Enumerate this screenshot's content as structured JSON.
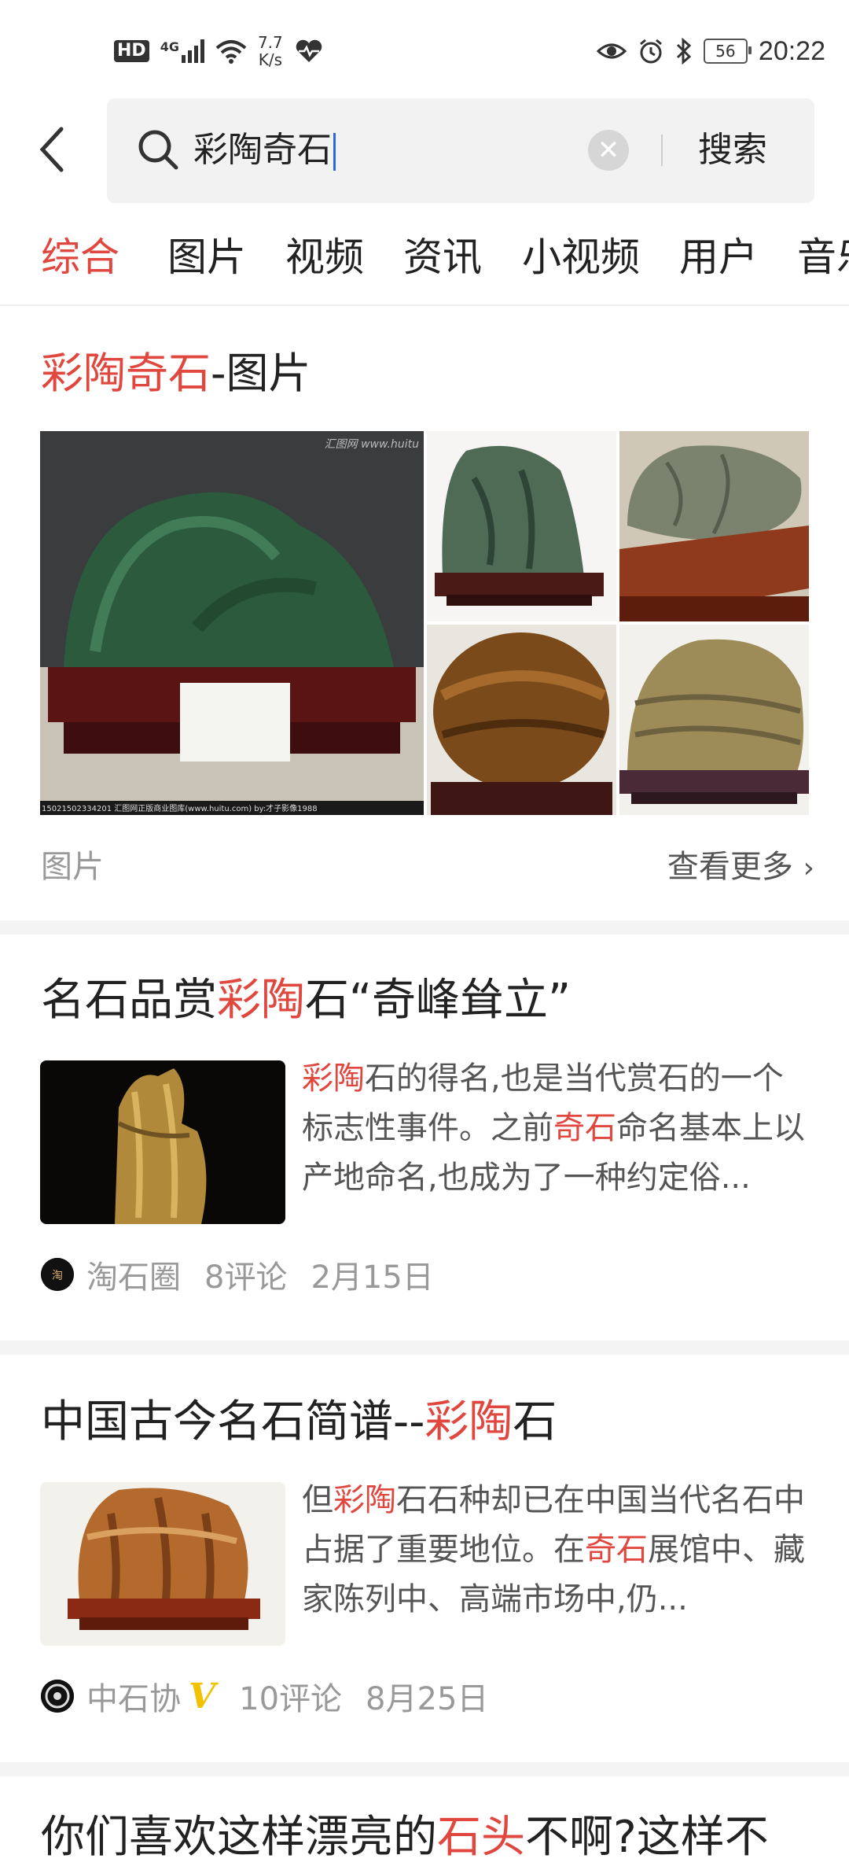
{
  "status_bar": {
    "hd": "HD",
    "network": "4G",
    "speed_value": "7.7",
    "speed_unit": "K/s",
    "battery": "56",
    "time": "20:22"
  },
  "search": {
    "query": "彩陶奇石",
    "submit_label": "搜索"
  },
  "tabs": [
    "综合",
    "图片",
    "视频",
    "资讯",
    "小视频",
    "用户",
    "音乐"
  ],
  "image_section": {
    "title_highlight": "彩陶奇石",
    "title_rest": "-图片",
    "watermark": "汇图网 www.huitu",
    "caption_bottom": "15021502334201  汇图网正版商业图库(www.huitu.com) by:才子影像1988",
    "footer_label": "图片",
    "more_label": "查看更多"
  },
  "articles": [
    {
      "title_pre": "名石品赏",
      "title_hl": "彩陶",
      "title_post": "石“奇峰耸立”",
      "snippet": [
        {
          "t": "彩陶",
          "hl": true
        },
        {
          "t": "石的得名,也是当代赏石的一个标志性事件。之前",
          "hl": false
        },
        {
          "t": "奇石",
          "hl": true
        },
        {
          "t": "命名基本上以产地命名,也成为了一种约定俗...",
          "hl": false
        }
      ],
      "source": "淘石圈",
      "comments": "8评论",
      "date": "2月15日"
    },
    {
      "title_pre": "中国古今名石简谱--",
      "title_hl": "彩陶",
      "title_post": "石",
      "snippet": [
        {
          "t": "但",
          "hl": false
        },
        {
          "t": "彩陶",
          "hl": true
        },
        {
          "t": "石石种却已在中国当代名石中占据了重要地位。在",
          "hl": false
        },
        {
          "t": "奇石",
          "hl": true
        },
        {
          "t": "展馆中、藏家陈列中、高端市场中,仍...",
          "hl": false
        }
      ],
      "source": "中石协",
      "verified": "V",
      "comments": "10评论",
      "date": "8月25日"
    },
    {
      "title_pre": "你们喜欢这样漂亮的",
      "title_hl": "石头",
      "title_post": "不啊?这样不"
    }
  ]
}
